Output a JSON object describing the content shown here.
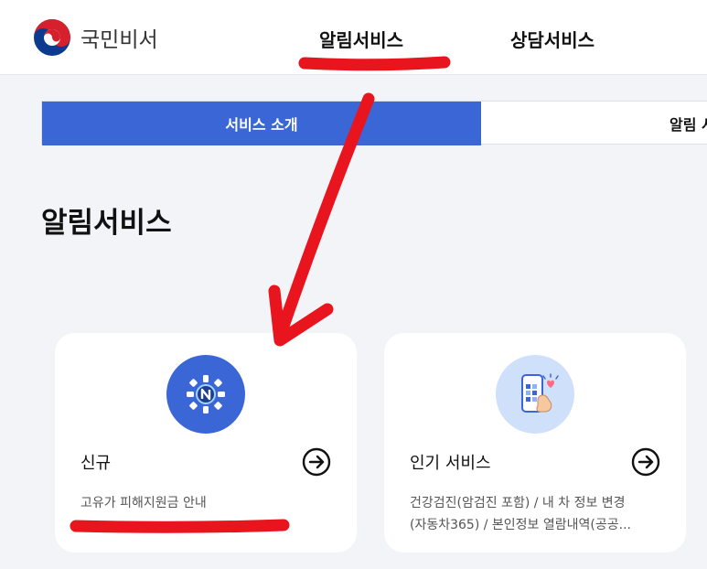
{
  "header": {
    "logo_text": "국민비서",
    "nav": [
      "알림서비스",
      "상담서비스"
    ]
  },
  "tabs": {
    "active": "서비스 소개",
    "second": "알림 서비스"
  },
  "page_title": "알림서비스",
  "cards": [
    {
      "title": "신규",
      "desc_lines": [
        "고유가 피해지원금 안내"
      ],
      "icon": "n-badge-icon",
      "icon_bg": "#3a66d6"
    },
    {
      "title": "인기 서비스",
      "desc_lines": [
        "건강검진(암검진 포함)  / 내 차 정보 변경",
        "(자동차365)  / 본인정보 열람내역(공공..."
      ],
      "icon": "phone-heart-icon",
      "icon_bg": "#cfe0fb"
    }
  ],
  "colors": {
    "accent": "#3a66d6",
    "annotation": "#e8141e"
  }
}
